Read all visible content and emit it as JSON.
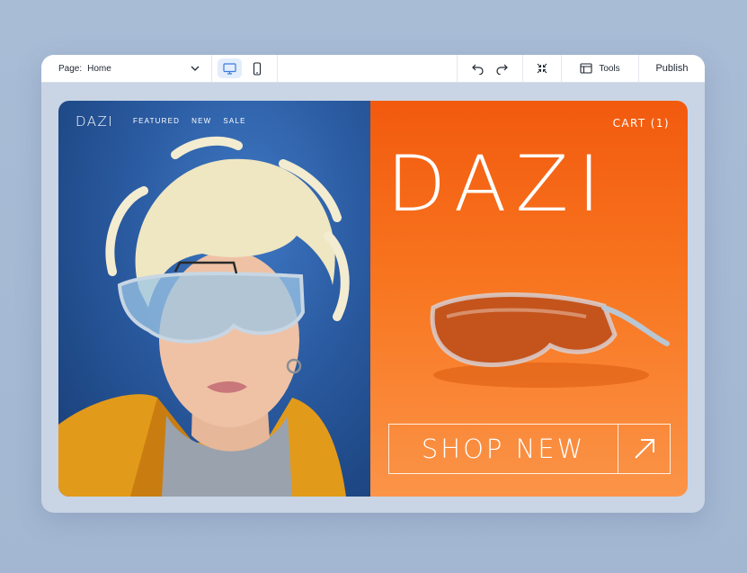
{
  "toolbar": {
    "page_label": "Page:",
    "page_value": "Home",
    "tools_label": "Tools",
    "publish_label": "Publish"
  },
  "site": {
    "brand": "DAZI",
    "nav": [
      "FEATURED",
      "NEW",
      "SALE"
    ],
    "cart": "CART (1)",
    "hero_title": "DAZI",
    "cta": "SHOP NEW"
  },
  "colors": {
    "accent": "#f25a0e",
    "left_panel": "#2a5aa0",
    "toolbar_active": "#e3edfb"
  },
  "icons": [
    "chevron-down-icon",
    "desktop-icon",
    "mobile-icon",
    "undo-icon",
    "redo-icon",
    "collapse-icon",
    "tools-icon",
    "arrow-up-right-icon"
  ]
}
